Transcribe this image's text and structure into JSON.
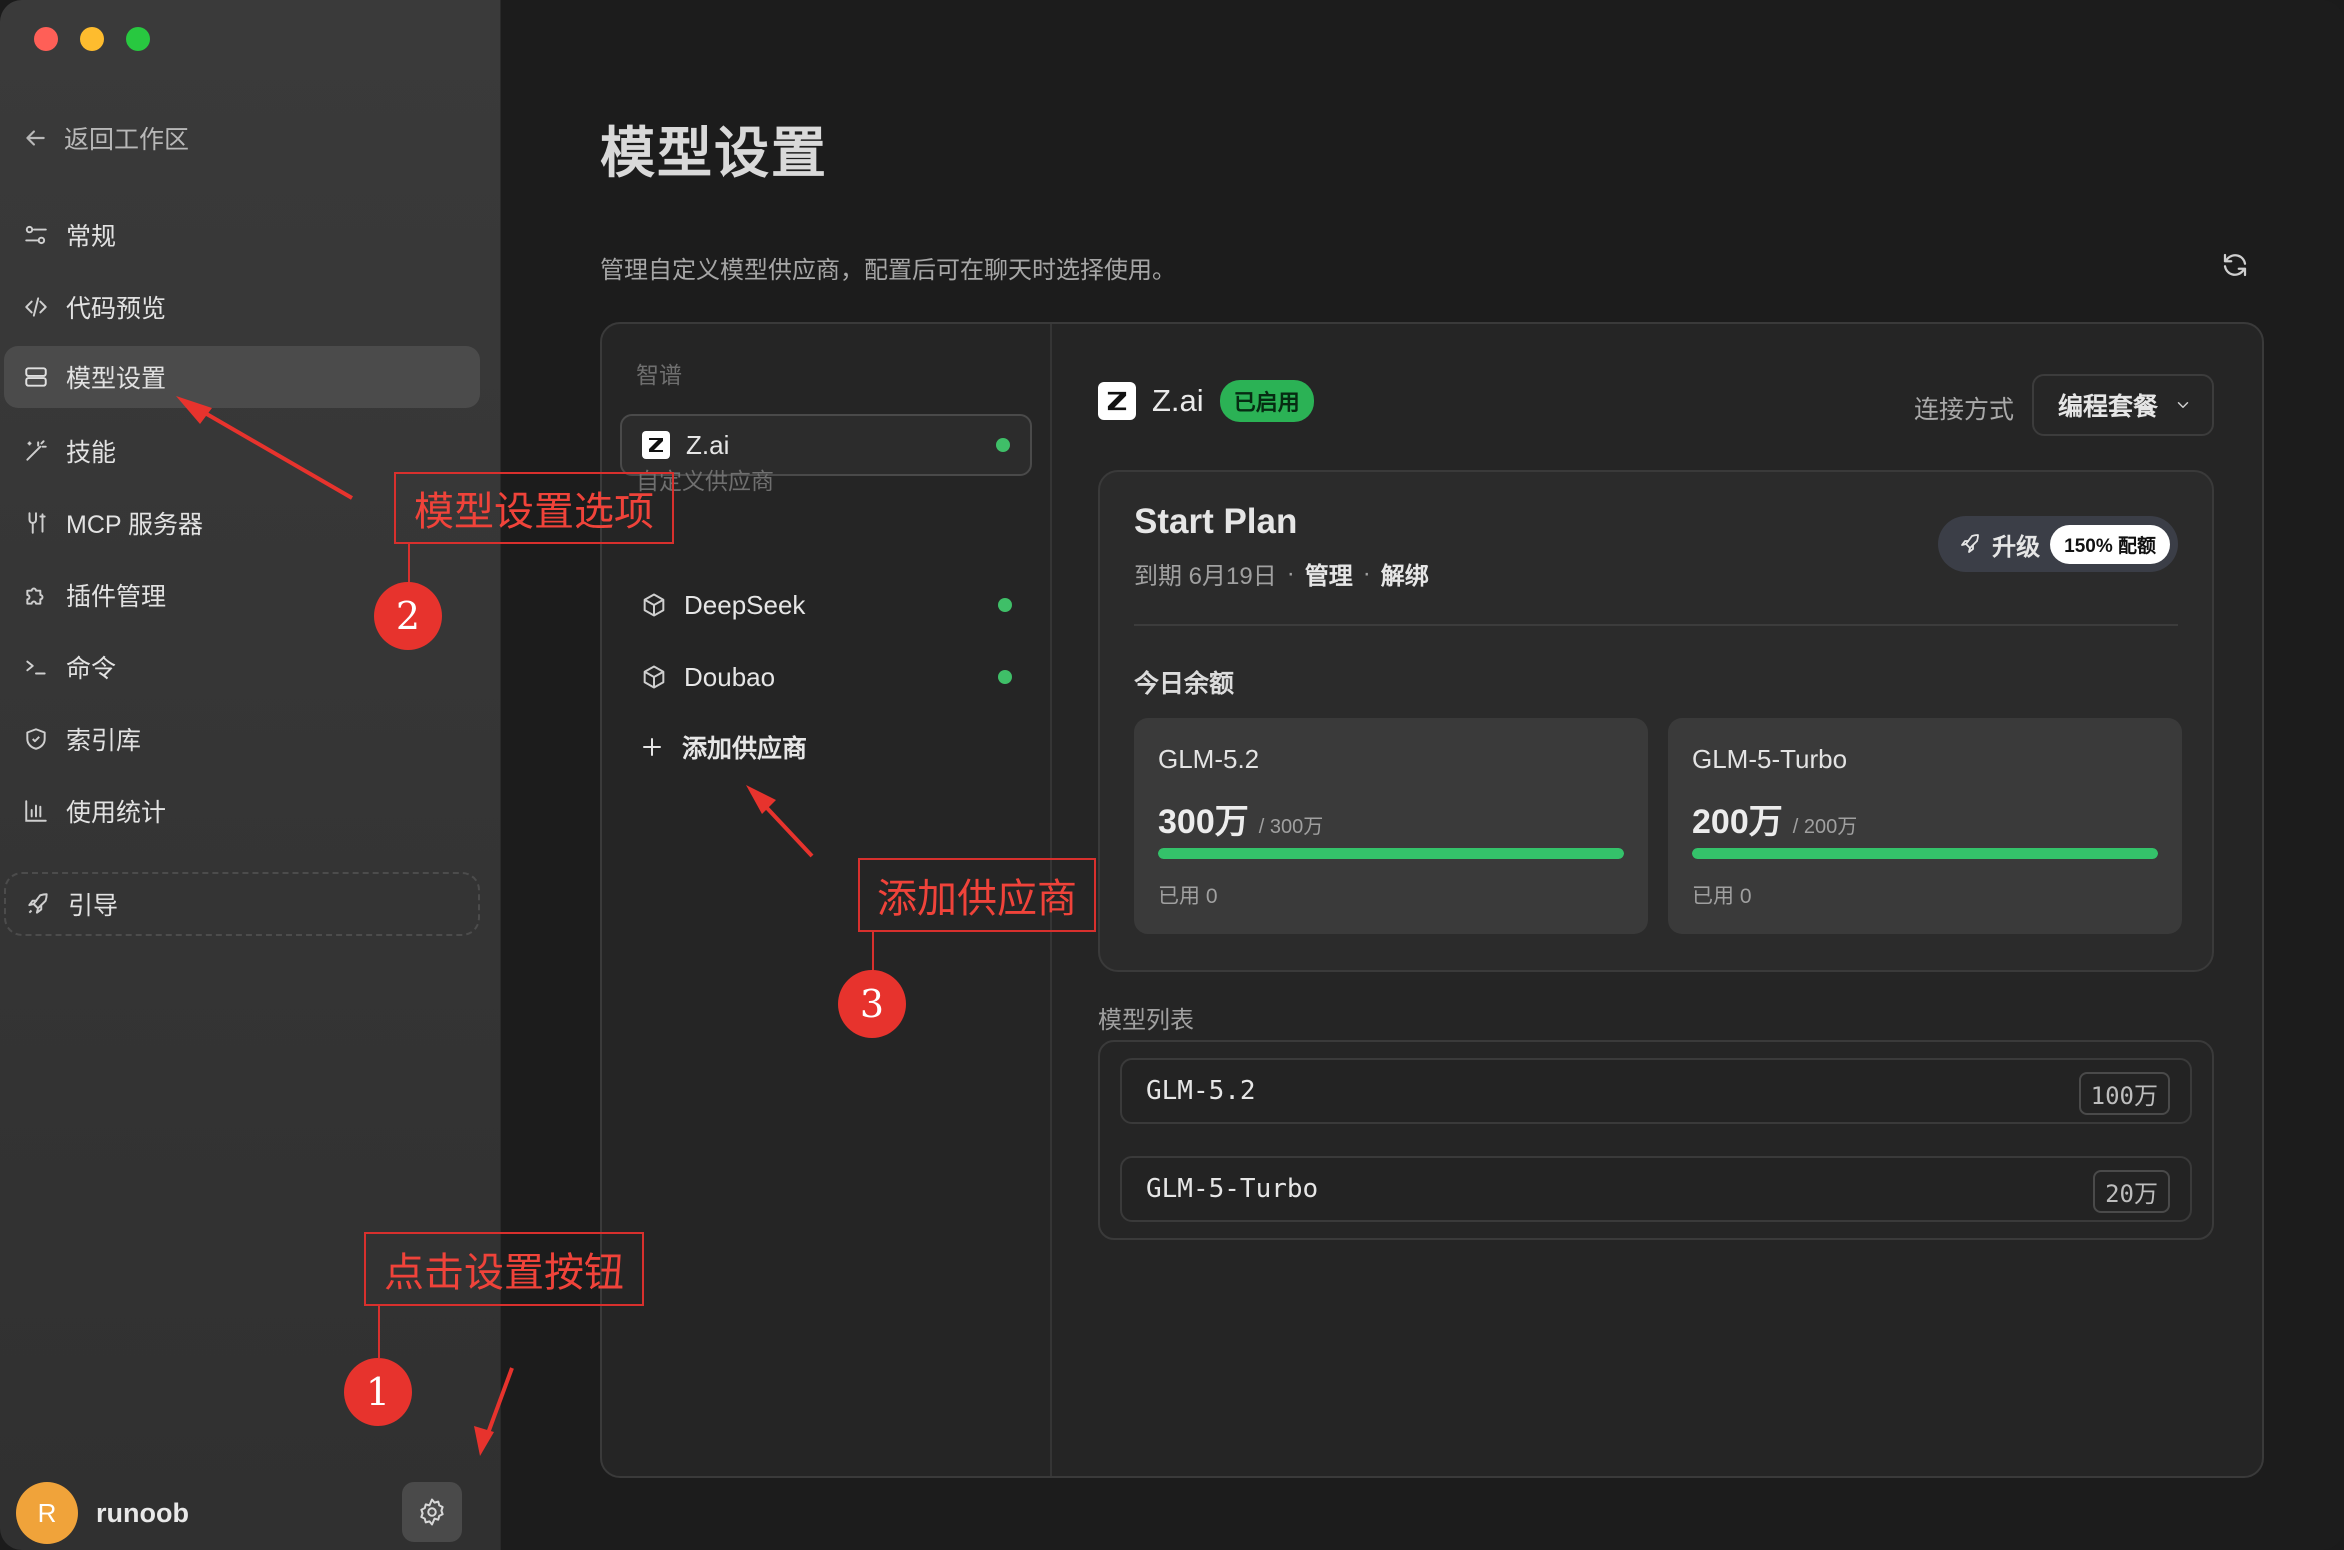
{
  "sidebar": {
    "back_label": "返回工作区",
    "items": [
      {
        "label": "常规",
        "icon": "sliders-icon"
      },
      {
        "label": "代码预览",
        "icon": "code-icon"
      },
      {
        "label": "模型设置",
        "icon": "server-icon",
        "active": true
      },
      {
        "label": "技能",
        "icon": "magic-wand-icon"
      },
      {
        "label": "MCP 服务器",
        "icon": "plug-icon"
      },
      {
        "label": "插件管理",
        "icon": "puzzle-icon"
      },
      {
        "label": "命令",
        "icon": "terminal-icon"
      },
      {
        "label": "索引库",
        "icon": "shield-icon"
      },
      {
        "label": "使用统计",
        "icon": "bar-chart-icon"
      }
    ],
    "guide_label": "引导",
    "user": {
      "avatar_letter": "R",
      "name": "runoob"
    }
  },
  "page": {
    "title": "模型设置",
    "description": "管理自定义模型供应商，配置后可在聊天时选择使用。"
  },
  "providers": {
    "group_zhipu": "智谱",
    "zhipu_items": [
      {
        "name": "Z.ai",
        "enabled": true
      }
    ],
    "group_custom": "自定义供应商",
    "custom_items": [
      {
        "name": "DeepSeek",
        "enabled": true
      },
      {
        "name": "Doubao",
        "enabled": true
      }
    ],
    "add_label": "添加供应商"
  },
  "detail": {
    "name": "Z.ai",
    "status_badge": "已启用",
    "connection_label": "连接方式",
    "connection_value": "编程套餐",
    "plan": {
      "name": "Start Plan",
      "expiry": "到期 6月19日",
      "manage": "管理",
      "unbind": "解绑",
      "upgrade_label": "升级",
      "quota_pill": "150% 配额"
    },
    "today_label": "今日余额",
    "quotas": [
      {
        "model": "GLM-5.2",
        "remaining": "300万",
        "total": "/ 300万",
        "used": "已用 0",
        "fill_fraction": 1.0
      },
      {
        "model": "GLM-5-Turbo",
        "remaining": "200万",
        "total": "/ 200万",
        "used": "已用 0",
        "fill_fraction": 1.0
      }
    ],
    "model_list_label": "模型列表",
    "models": [
      {
        "name": "GLM-5.2",
        "tokens": "100万"
      },
      {
        "name": "GLM-5-Turbo",
        "tokens": "20万"
      }
    ]
  },
  "annotations": {
    "box1": "点击设置按钮",
    "box2": "模型设置选项",
    "box3": "添加供应商",
    "num1": "1",
    "num2": "2",
    "num3": "3"
  },
  "colors": {
    "accent_green": "#34c26a",
    "annotation_red": "#e7332d",
    "avatar": "#f0a33a"
  }
}
